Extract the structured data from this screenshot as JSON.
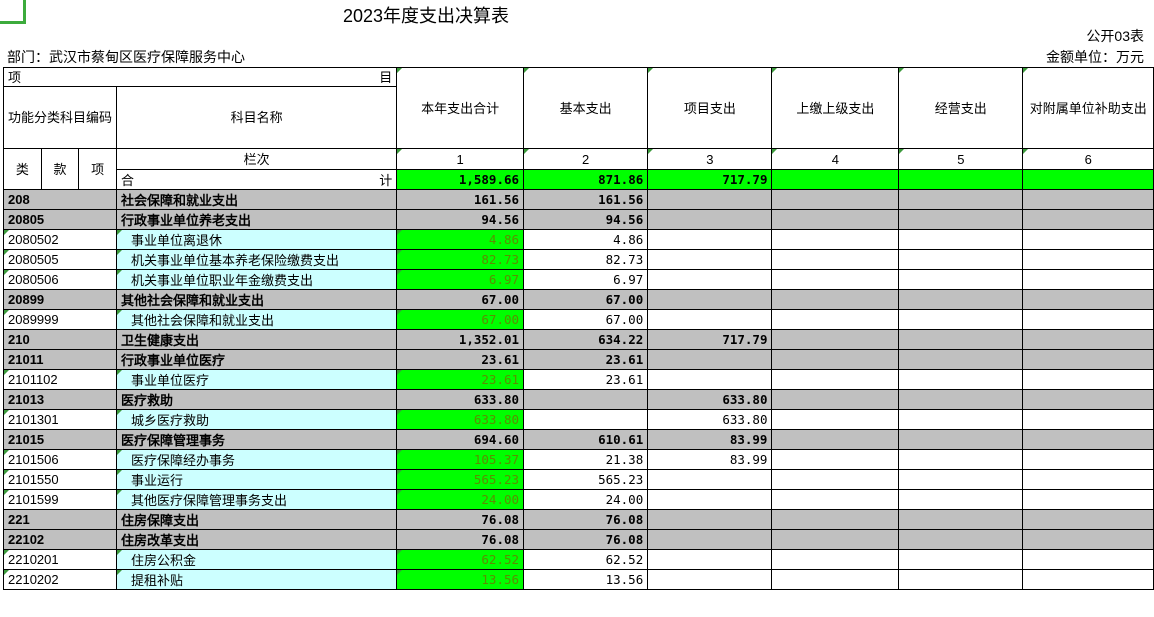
{
  "title": "2023年度支出决算表",
  "form_code": "公开03表",
  "department": "部门：武汉市蔡甸区医疗保障服务中心",
  "unit": "金额单位：万元",
  "header": {
    "item_left": "项",
    "item_right": "目",
    "func_code": "功能分类科目编码",
    "subject_name": "科目名称",
    "col_index": "栏次",
    "lei": "类",
    "kuan": "款",
    "xiang": "项",
    "cols": [
      "本年支出合计",
      "基本支出",
      "项目支出",
      "上缴上级支出",
      "经营支出",
      "对附属单位补助支出"
    ],
    "col_nums": [
      "1",
      "2",
      "3",
      "4",
      "5",
      "6"
    ]
  },
  "total": {
    "left": "合",
    "right": "计",
    "values": [
      "1,589.66",
      "871.86",
      "717.79",
      "",
      "",
      ""
    ]
  },
  "rows": [
    {
      "level": 1,
      "code": "208",
      "name": "社会保障和就业支出",
      "values": [
        "161.56",
        "161.56",
        "",
        "",
        "",
        ""
      ]
    },
    {
      "level": 2,
      "code": "20805",
      "name": "行政事业单位养老支出",
      "values": [
        "94.56",
        "94.56",
        "",
        "",
        "",
        ""
      ]
    },
    {
      "level": 3,
      "code": "2080502",
      "name": "事业单位离退休",
      "values": [
        "4.86",
        "4.86",
        "",
        "",
        "",
        ""
      ]
    },
    {
      "level": 3,
      "code": "2080505",
      "name": "机关事业单位基本养老保险缴费支出",
      "values": [
        "82.73",
        "82.73",
        "",
        "",
        "",
        ""
      ]
    },
    {
      "level": 3,
      "code": "2080506",
      "name": "机关事业单位职业年金缴费支出",
      "values": [
        "6.97",
        "6.97",
        "",
        "",
        "",
        ""
      ]
    },
    {
      "level": 2,
      "code": "20899",
      "name": "其他社会保障和就业支出",
      "values": [
        "67.00",
        "67.00",
        "",
        "",
        "",
        ""
      ]
    },
    {
      "level": 3,
      "code": "2089999",
      "name": "其他社会保障和就业支出",
      "values": [
        "67.00",
        "67.00",
        "",
        "",
        "",
        ""
      ]
    },
    {
      "level": 1,
      "code": "210",
      "name": "卫生健康支出",
      "values": [
        "1,352.01",
        "634.22",
        "717.79",
        "",
        "",
        ""
      ]
    },
    {
      "level": 2,
      "code": "21011",
      "name": "行政事业单位医疗",
      "values": [
        "23.61",
        "23.61",
        "",
        "",
        "",
        ""
      ]
    },
    {
      "level": 3,
      "code": "2101102",
      "name": "事业单位医疗",
      "values": [
        "23.61",
        "23.61",
        "",
        "",
        "",
        ""
      ]
    },
    {
      "level": 2,
      "code": "21013",
      "name": "医疗救助",
      "values": [
        "633.80",
        "",
        "633.80",
        "",
        "",
        ""
      ]
    },
    {
      "level": 3,
      "code": "2101301",
      "name": "城乡医疗救助",
      "values": [
        "633.80",
        "",
        "633.80",
        "",
        "",
        ""
      ]
    },
    {
      "level": 2,
      "code": "21015",
      "name": "医疗保障管理事务",
      "values": [
        "694.60",
        "610.61",
        "83.99",
        "",
        "",
        ""
      ]
    },
    {
      "level": 3,
      "code": "2101506",
      "name": "医疗保障经办事务",
      "values": [
        "105.37",
        "21.38",
        "83.99",
        "",
        "",
        ""
      ]
    },
    {
      "level": 3,
      "code": "2101550",
      "name": "事业运行",
      "values": [
        "565.23",
        "565.23",
        "",
        "",
        "",
        ""
      ]
    },
    {
      "level": 3,
      "code": "2101599",
      "name": "其他医疗保障管理事务支出",
      "values": [
        "24.00",
        "24.00",
        "",
        "",
        "",
        ""
      ]
    },
    {
      "level": 1,
      "code": "221",
      "name": "住房保障支出",
      "values": [
        "76.08",
        "76.08",
        "",
        "",
        "",
        ""
      ]
    },
    {
      "level": 2,
      "code": "22102",
      "name": "住房改革支出",
      "values": [
        "76.08",
        "76.08",
        "",
        "",
        "",
        ""
      ]
    },
    {
      "level": 3,
      "code": "2210201",
      "name": "住房公积金",
      "values": [
        "62.52",
        "62.52",
        "",
        "",
        "",
        ""
      ]
    },
    {
      "level": 3,
      "code": "2210202",
      "name": "提租补贴",
      "values": [
        "13.56",
        "13.56",
        "",
        "",
        "",
        ""
      ]
    }
  ]
}
